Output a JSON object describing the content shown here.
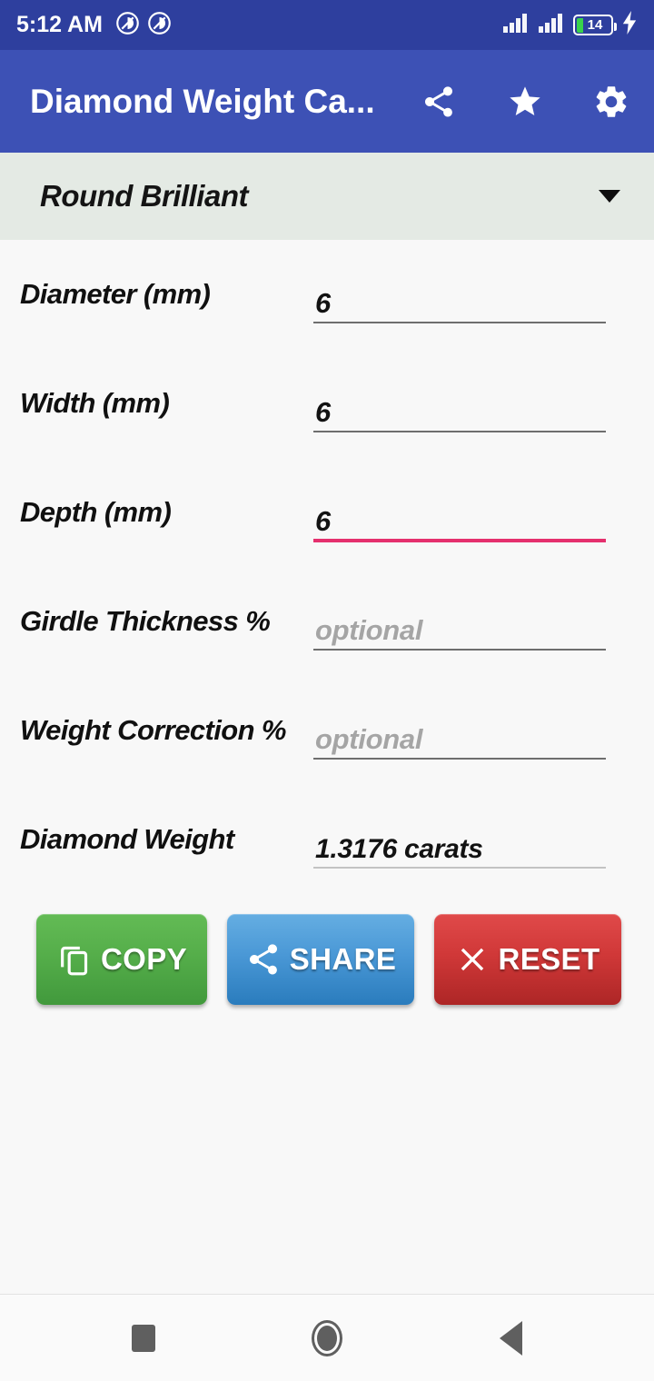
{
  "status_bar": {
    "time": "5:12 AM",
    "battery_percent": "14",
    "icons": [
      "do-not-disturb-icon",
      "do-not-disturb-icon",
      "signal-bars-icon",
      "signal-bars-icon",
      "battery-icon",
      "charging-bolt-icon"
    ],
    "background_color": "#2e3f9e"
  },
  "app_bar": {
    "title": "Diamond Weight Ca...",
    "background_color": "#3d51b5",
    "actions": [
      {
        "name": "share-icon",
        "label": "Share"
      },
      {
        "name": "star-icon",
        "label": "Favorite"
      },
      {
        "name": "gear-icon",
        "label": "Settings"
      }
    ]
  },
  "shape_selector": {
    "selected": "Round Brilliant",
    "background_color": "#e4eae4",
    "options": [
      "Round Brilliant"
    ]
  },
  "form": {
    "rows": [
      {
        "label": "Diameter (mm)",
        "value": "6",
        "placeholder": "",
        "state": "filled"
      },
      {
        "label": "Width (mm)",
        "value": "6",
        "placeholder": "",
        "state": "filled"
      },
      {
        "label": "Depth (mm)",
        "value": "6",
        "placeholder": "",
        "state": "focused"
      },
      {
        "label": "Girdle Thickness %",
        "value": "",
        "placeholder": "optional",
        "state": "empty"
      },
      {
        "label": "Weight Correction %",
        "value": "",
        "placeholder": "optional",
        "state": "empty"
      },
      {
        "label": "Diamond Weight",
        "value": "1.3176 carats",
        "placeholder": "",
        "state": "readonly"
      }
    ],
    "focus_color": "#e5306e"
  },
  "buttons": [
    {
      "label": "COPY",
      "icon": "copy-icon",
      "color": "#55ae4a"
    },
    {
      "label": "SHARE",
      "icon": "share-icon",
      "color": "#4a98d6"
    },
    {
      "label": "RESET",
      "icon": "close-x-icon",
      "color": "#d03838"
    }
  ],
  "nav_bar": {
    "items": [
      {
        "name": "recents-square-icon",
        "label": "Recents"
      },
      {
        "name": "home-circle-icon",
        "label": "Home"
      },
      {
        "name": "back-triangle-icon",
        "label": "Back"
      }
    ]
  }
}
